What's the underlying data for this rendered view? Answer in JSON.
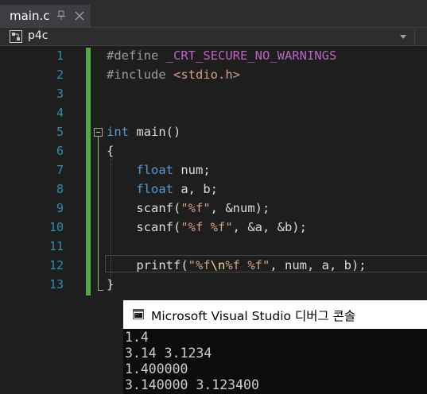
{
  "tab": {
    "label": "main.c",
    "pin_icon": "pin-icon",
    "close_icon": "close-icon"
  },
  "navbar": {
    "scope": "p4c",
    "scope_icon": "project-scope-icon"
  },
  "editor": {
    "line_numbers": [
      "1",
      "2",
      "3",
      "4",
      "5",
      "6",
      "7",
      "8",
      "9",
      "10",
      "11",
      "12",
      "13"
    ],
    "code": {
      "l1": {
        "directive": "#define",
        "sp": " ",
        "macro": "_CRT_SECURE_NO_WARNINGS"
      },
      "l2": {
        "directive": "#include",
        "sp": " ",
        "header": "<stdio.h>"
      },
      "l5": {
        "type": "int",
        "rest": " main()"
      },
      "l6": {
        "text": "{"
      },
      "l7": {
        "indent": "    ",
        "type": "float",
        "rest": " num;"
      },
      "l8": {
        "indent": "    ",
        "type": "float",
        "rest": " a, b;"
      },
      "l9": {
        "indent": "    ",
        "func": "scanf(",
        "str": "\"%f\"",
        "rest": ", &num);"
      },
      "l10": {
        "indent": "    ",
        "func": "scanf(",
        "str": "\"%f %f\"",
        "rest": ", &a, &b);"
      },
      "l12": {
        "indent": "    ",
        "func": "printf(",
        "str1": "\"%f",
        "esc": "\\n",
        "str2": "%f %f\"",
        "rest": ", num, a, b);"
      },
      "l13": {
        "text": "}"
      }
    }
  },
  "console": {
    "title": "Microsoft Visual Studio 디버그 콘솔",
    "icon": "console-icon",
    "lines": [
      "1.4",
      "3.14 3.1234",
      "1.400000",
      "3.140000 3.123400"
    ]
  },
  "colors": {
    "background": "#1e1e1e",
    "line_number": "#2b91af",
    "keyword": "#569cd6",
    "string": "#d69d85",
    "macro": "#bd63c5",
    "escape": "#ffd68f",
    "change_bar": "#57a64a",
    "console_bg": "#0c0c0c"
  }
}
